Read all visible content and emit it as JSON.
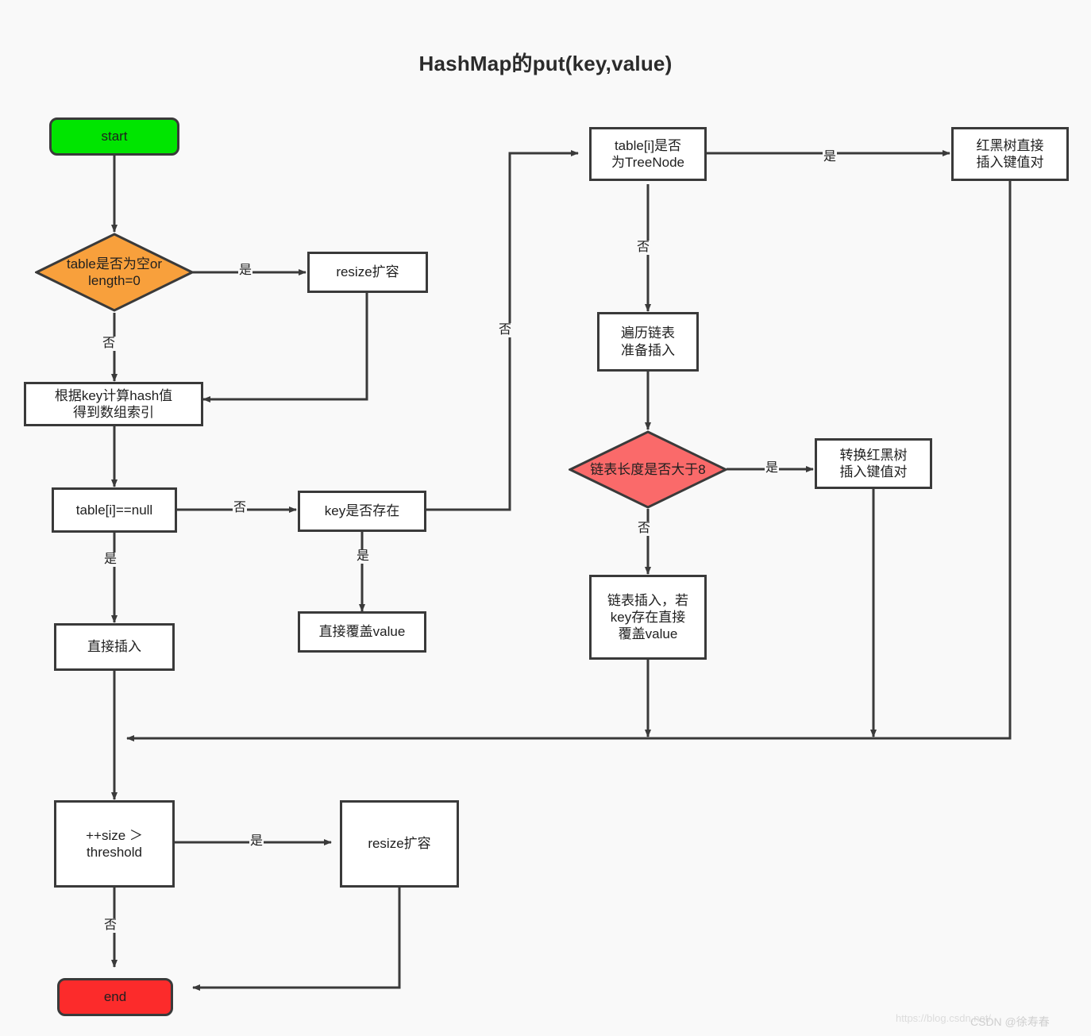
{
  "title": "HashMap的put(key,value)",
  "colors": {
    "start_fill": "#00e500",
    "end_fill": "#fc2b2b",
    "decision_orange": "#f8a03c",
    "decision_red": "#fa6a6a",
    "node_fill": "#ffffff",
    "stroke": "#3a3a3a",
    "background": "#f9f9f9",
    "text": "#1f1f1f"
  },
  "nodes": {
    "start": {
      "label": "start",
      "shape": "rounded-rect"
    },
    "table_empty": {
      "label": "table是否为空or\nlength=0",
      "shape": "diamond"
    },
    "resize_top": {
      "label": "resize扩容",
      "shape": "rect"
    },
    "calc_hash": {
      "label": "根据key计算hash值\n得到数组索引",
      "shape": "rect"
    },
    "table_i_null": {
      "label": "table[i]==null",
      "shape": "rect"
    },
    "key_exists": {
      "label": "key是否存在",
      "shape": "rect"
    },
    "overwrite_value": {
      "label": "直接覆盖value",
      "shape": "rect"
    },
    "direct_insert": {
      "label": "直接插入",
      "shape": "rect"
    },
    "is_treenode": {
      "label": "table[i]是否\n为TreeNode",
      "shape": "rect"
    },
    "rbtree_insert": {
      "label": "红黑树直接\n插入键值对",
      "shape": "rect"
    },
    "traverse_list": {
      "label": "遍历链表\n准备插入",
      "shape": "rect"
    },
    "list_len_gt8": {
      "label": "链表长度是否大于8",
      "shape": "diamond"
    },
    "convert_rbtree": {
      "label": "转换红黑树\n插入键值对",
      "shape": "rect"
    },
    "list_insert": {
      "label": "链表插入，若\nkey存在直接\n覆盖value",
      "shape": "rect"
    },
    "size_threshold": {
      "label": "++size ＞\nthreshold",
      "shape": "rect"
    },
    "resize_bottom": {
      "label": "resize扩容",
      "shape": "rect"
    },
    "end": {
      "label": "end",
      "shape": "rounded-rect"
    }
  },
  "edge_labels": {
    "table_empty_yes": "是",
    "table_empty_no": "否",
    "table_i_null_no": "否",
    "table_i_null_yes": "是",
    "key_exists_yes": "是",
    "key_exists_no": "否",
    "is_treenode_yes": "是",
    "is_treenode_no": "否",
    "list_len_yes": "是",
    "list_len_no": "否",
    "size_threshold_yes": "是",
    "size_threshold_no": "否"
  },
  "watermark": {
    "url": "https://blog.csdn.net/",
    "name": "CSDN @徐寿春"
  }
}
